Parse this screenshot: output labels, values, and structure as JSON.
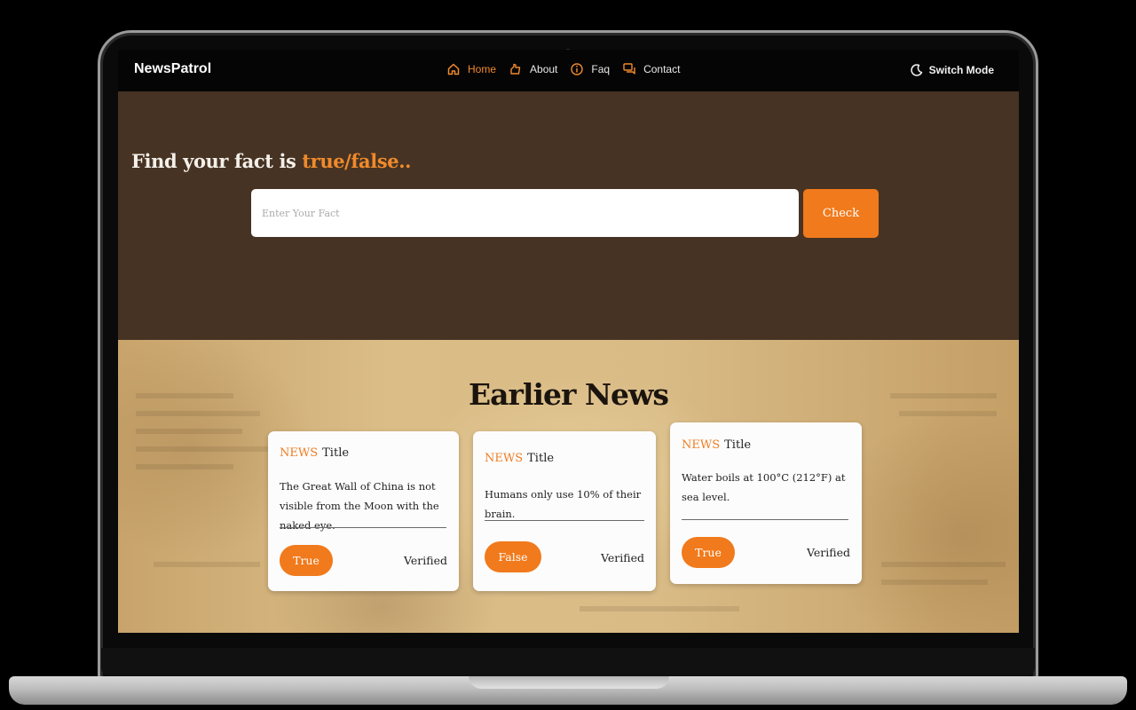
{
  "navbar": {
    "brand": "NewsPatrol",
    "links": [
      {
        "label": "Home",
        "icon": "home-icon",
        "active": true
      },
      {
        "label": "About",
        "icon": "hand-icon",
        "active": false
      },
      {
        "label": "Faq",
        "icon": "info-icon",
        "active": false
      },
      {
        "label": "Contact",
        "icon": "chat-icon",
        "active": false
      }
    ],
    "switch_mode": "Switch Mode"
  },
  "hero": {
    "title_prefix": "Find your fact is ",
    "title_accent": "true/false..",
    "input_placeholder": "Enter Your Fact",
    "check_label": "Check"
  },
  "news": {
    "section_title": "Earlier News",
    "cards": [
      {
        "tag": "NEWS",
        "title": "Title",
        "text": "The Great Wall of China is not visible from the Moon with the naked eye.",
        "verdict": "True",
        "status": "Verified"
      },
      {
        "tag": "NEWS",
        "title": "Title",
        "text": "Humans only use 10% of their brain.",
        "verdict": "False",
        "status": "Verified"
      },
      {
        "tag": "NEWS",
        "title": "Title",
        "text": "Water boils at 100°C (212°F) at sea level.",
        "verdict": "True",
        "status": "Verified"
      }
    ]
  },
  "colors": {
    "accent": "#f17a1c",
    "hero_bg": "#463323",
    "navbar_bg": "#050505"
  }
}
